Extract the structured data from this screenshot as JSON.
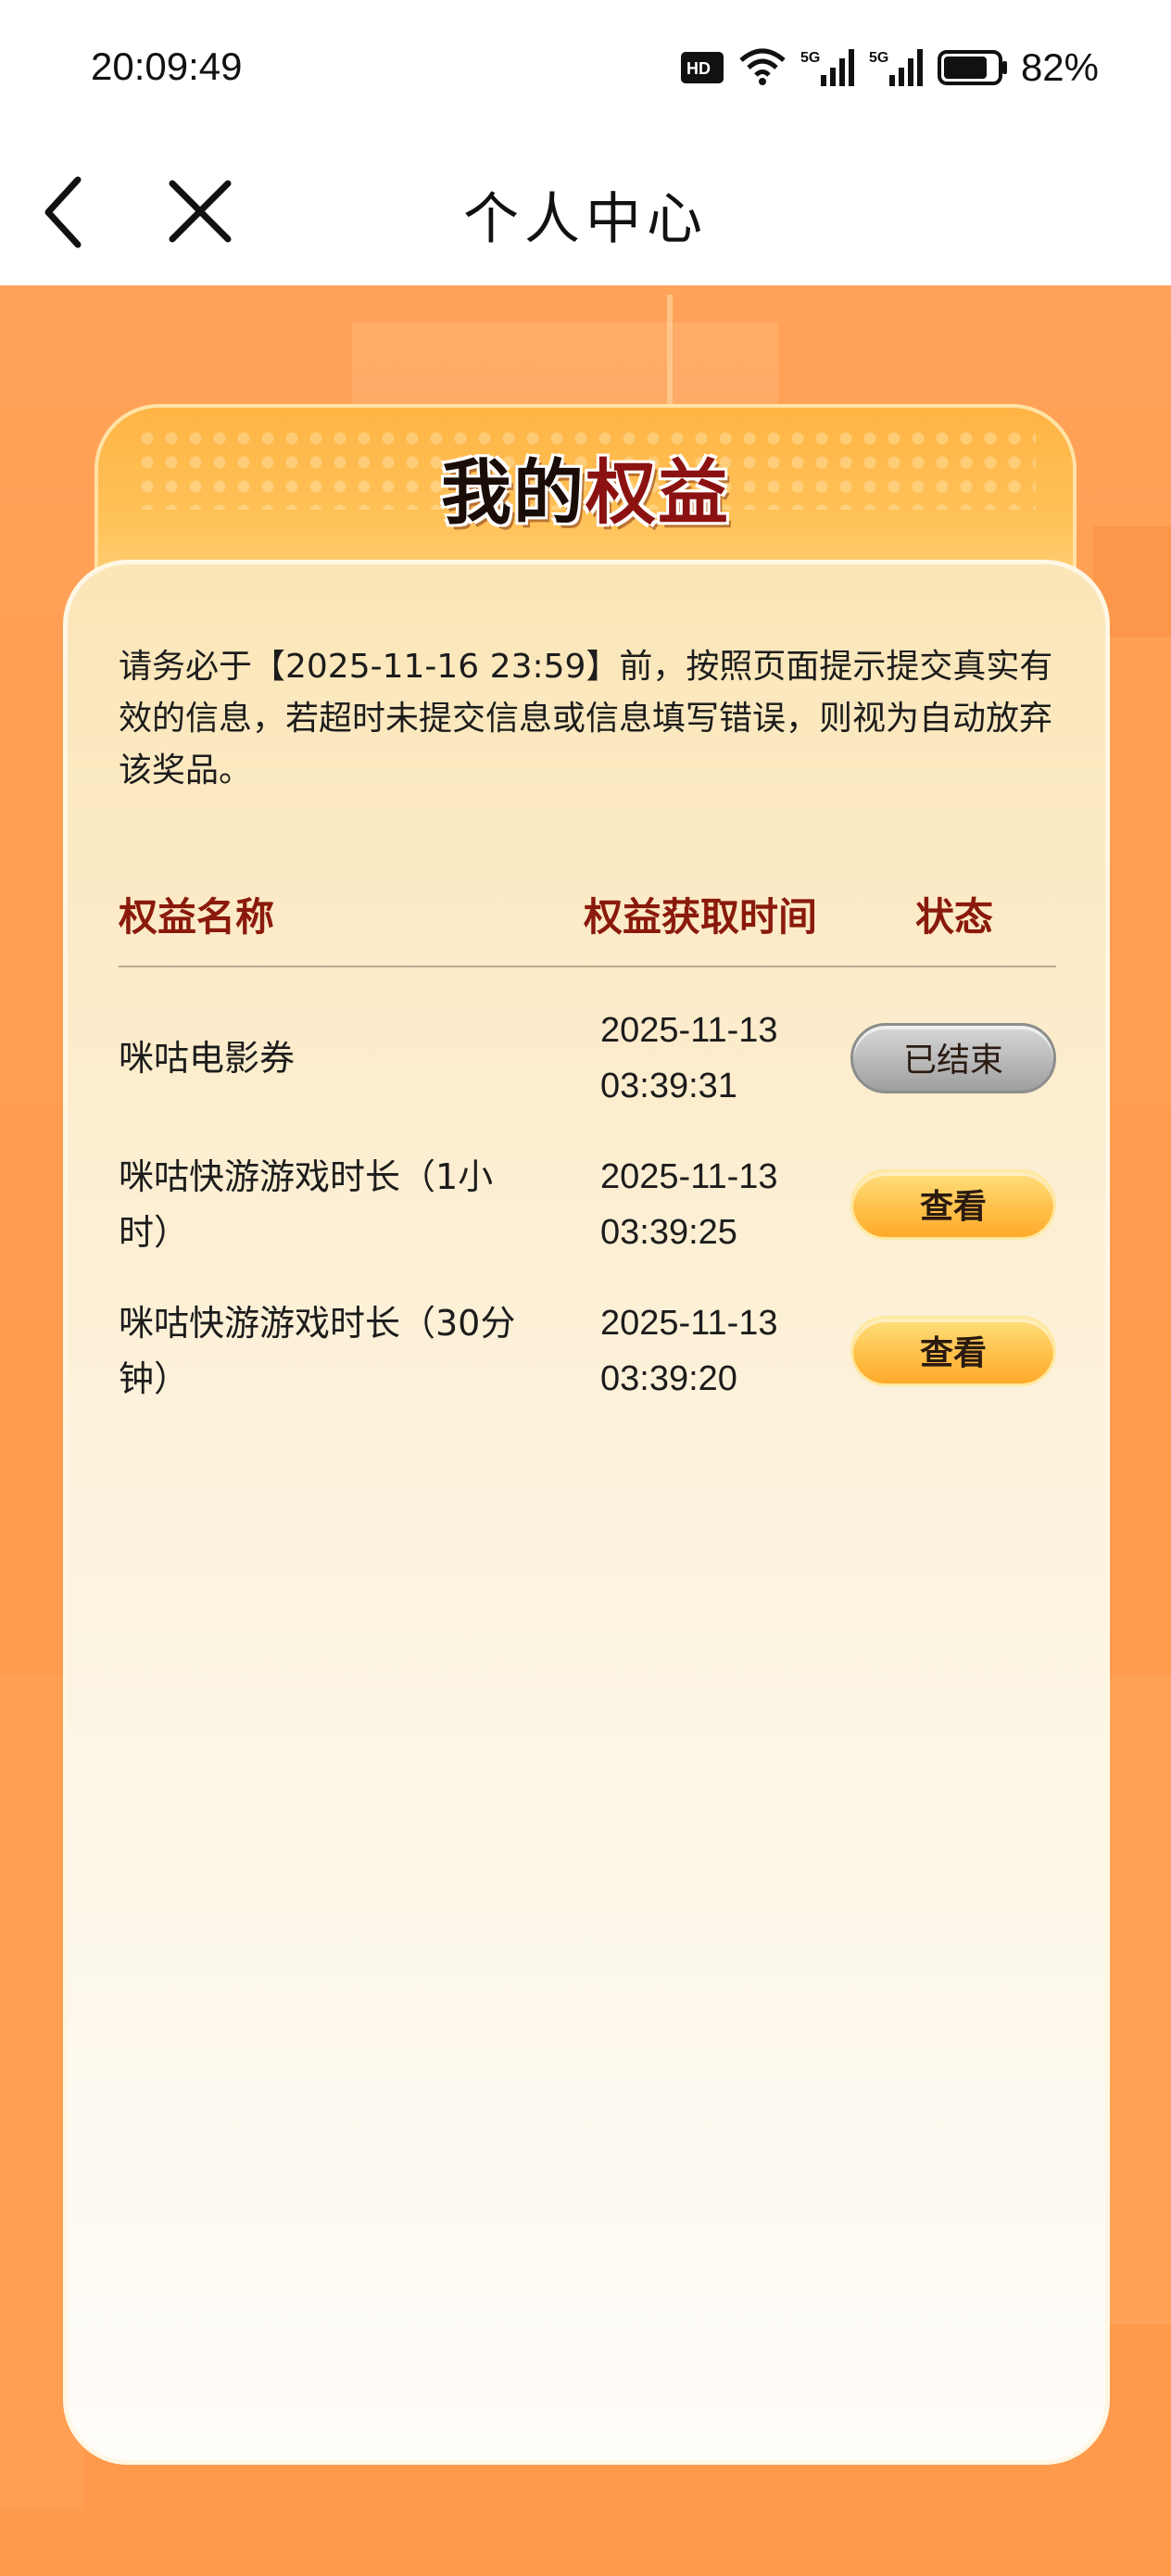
{
  "status_bar": {
    "time": "20:09:49",
    "battery": "82%",
    "icons": [
      "hd-icon",
      "wifi-icon",
      "5g-signal-icon",
      "5g-signal-icon",
      "battery-icon"
    ],
    "hd_label": "HD",
    "sim1_label": "5G",
    "sim2_label": "5G",
    "battery_level": 0.82
  },
  "nav": {
    "title": "个人中心"
  },
  "card": {
    "title_part1": "我的",
    "title_part2": "权益",
    "notice": "请务必于【2025-11-16 23:59】前，按照页面提示提交真实有效的信息，若超时未提交信息或信息填写错误，则视为自动放弃该奖品。"
  },
  "table": {
    "headers": {
      "name": "权益名称",
      "time": "权益获取时间",
      "status": "状态"
    },
    "rows": [
      {
        "name": "咪咕电影券",
        "date": "2025-11-13",
        "clock": "03:39:31",
        "status": "已结束"
      },
      {
        "name": "咪咕快游游戏时长（1小时）",
        "date": "2025-11-13",
        "clock": "03:39:25",
        "status": "查看"
      },
      {
        "name": "咪咕快游游戏时长（30分钟）",
        "date": "2025-11-13",
        "clock": "03:39:20",
        "status": "查看"
      }
    ]
  },
  "colors": {
    "page_bg": "#ff9c4f",
    "header_text": "#8a1a0c",
    "btn_view": "#ffc14a",
    "btn_ended": "#b9b9b9"
  }
}
